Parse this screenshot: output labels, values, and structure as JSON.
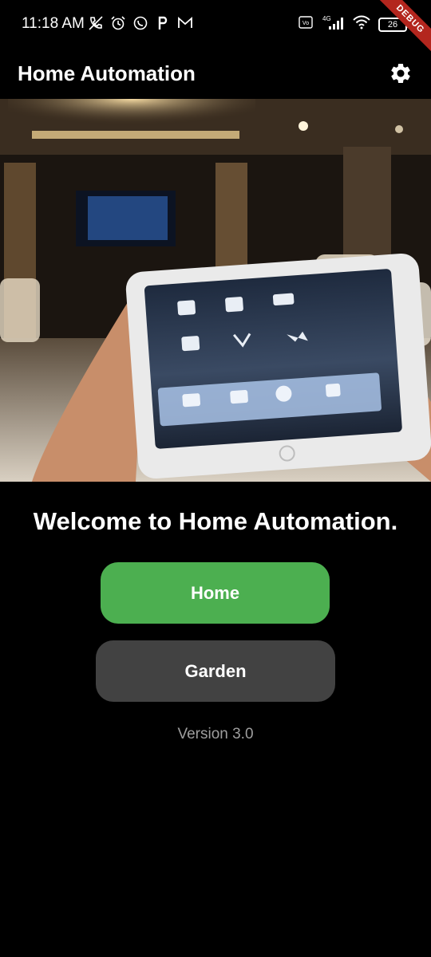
{
  "status_bar": {
    "time": "11:18 AM",
    "battery": "26",
    "left_icons": [
      "muted-call-icon",
      "alarm-icon",
      "whatsapp-icon",
      "p-app-icon",
      "gmail-icon"
    ],
    "right_icons": [
      "volte-icon",
      "signal-4g-icon",
      "wifi-icon",
      "battery-icon"
    ],
    "debug_label": "DEBUG"
  },
  "app_bar": {
    "title": "Home Automation",
    "settings_icon": "gear-icon"
  },
  "hero": {
    "description_icon": "tablet-smart-home-photo"
  },
  "main": {
    "welcome": "Welcome to Home Automation.",
    "home_button": "Home",
    "garden_button": "Garden",
    "version": "Version 3.0"
  },
  "colors": {
    "background": "#000000",
    "home_button": "#4caf50",
    "garden_button": "#424242",
    "version_text": "#9e9e9e"
  }
}
